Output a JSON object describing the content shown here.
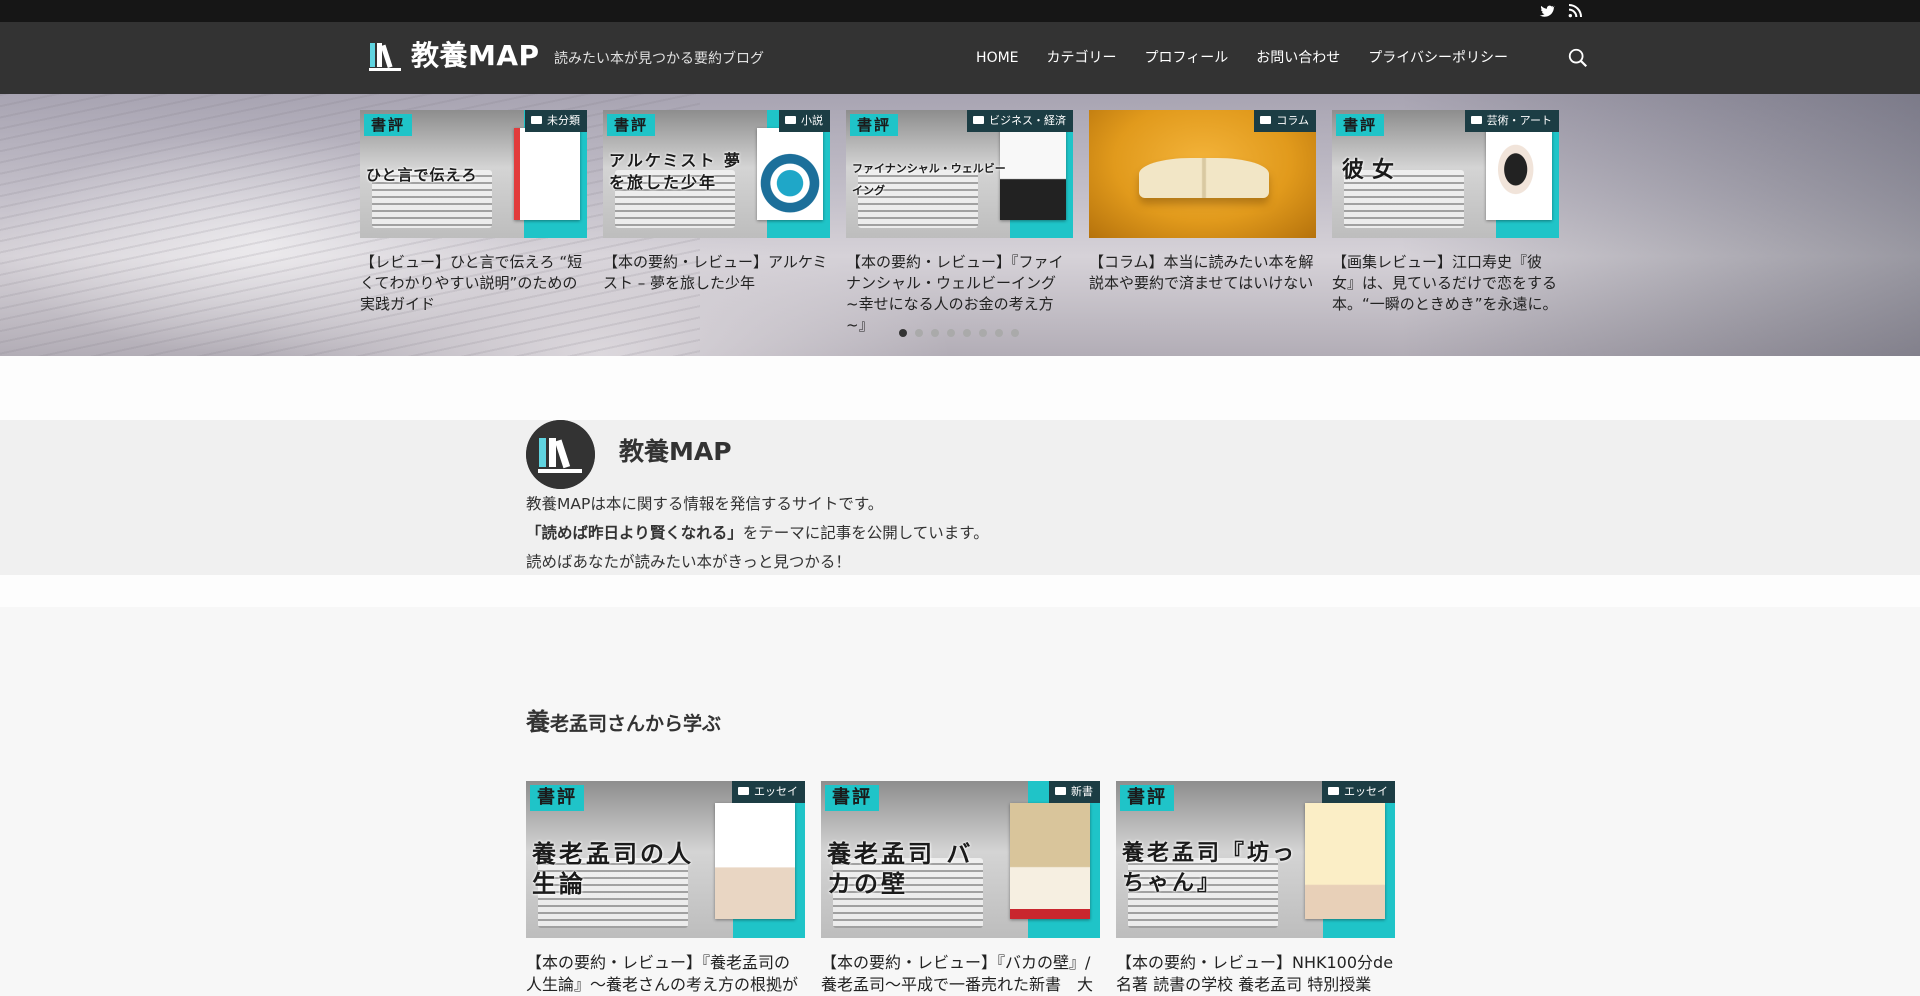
{
  "colors": {
    "topbar": "#161616",
    "header": "#333333",
    "accent": "#1fc4c8",
    "category_badge": "#1c3d44"
  },
  "topbar": {
    "icons": [
      "twitter-icon",
      "rss-icon"
    ]
  },
  "header": {
    "logo_text": "教養MAP",
    "tagline": "読みたい本が見つかる要約ブログ",
    "nav": [
      "HOME",
      "カテゴリー",
      "プロフィール",
      "お問い合わせ",
      "プライバシーポリシー"
    ],
    "search_icon": "search-icon"
  },
  "carousel": {
    "cards": [
      {
        "badge": "書評",
        "book": "ひと言で伝えろ",
        "category": "未分類",
        "title": "【レビュー】ひと言で伝えろ “短くてわかりやすい説明”のための実践ガイド"
      },
      {
        "badge": "書評",
        "book": "アルケミスト 夢を旅した少年",
        "category": "小説",
        "title": "【本の要約・レビュー】アルケミスト – 夢を旅した少年"
      },
      {
        "badge": "書評",
        "book": "ファイナンシャル・ウェルビーイング",
        "category": "ビジネス・経済",
        "title": "【本の要約・レビュー】『ファイナンシャル・ウェルビーイング ~幸せになる人のお金の考え方~』"
      },
      {
        "badge": "",
        "book": "",
        "category": "コラム",
        "title": "【コラム】本当に読みたい本を解説本や要約で済ませてはいけない"
      },
      {
        "badge": "書評",
        "book": "彼女",
        "category": "芸術・アート",
        "title": "【画集レビュー】江口寿史『彼女』は、見ているだけで恋をする本。“一瞬のときめき”を永遠に。"
      }
    ],
    "dots": 8,
    "active_dot": 1
  },
  "profile": {
    "name": "教養MAP",
    "line1": "教養MAPは本に関する情報を発信するサイトです。",
    "line2_bold": "「読めば昨日より賢くなれる」",
    "line2_rest": "をテーマに記事を公開しています。",
    "line3": "読めばあなたが読みたい本がきっと見つかる！"
  },
  "section": {
    "title_first": "養",
    "title_rest": "老孟司さんから学ぶ",
    "cards": [
      {
        "badge": "書評",
        "book": "養老孟司の人生論",
        "category": "エッセイ",
        "title": "【本の要約・レビュー】『養老孟司の人生論』～養老さんの考え方の根拠が"
      },
      {
        "badge": "書評",
        "book": "養老孟司 バカの壁",
        "category": "新書",
        "title": "【本の要約・レビュー】『バカの壁』/ 養老孟司～平成で一番売れた新書　大"
      },
      {
        "badge": "書評",
        "book": "養老孟司『坊っちゃん』",
        "category": "エッセイ",
        "title": "【本の要約・レビュー】NHK100分de名著 読書の学校 養老孟司 特別授業"
      }
    ]
  }
}
